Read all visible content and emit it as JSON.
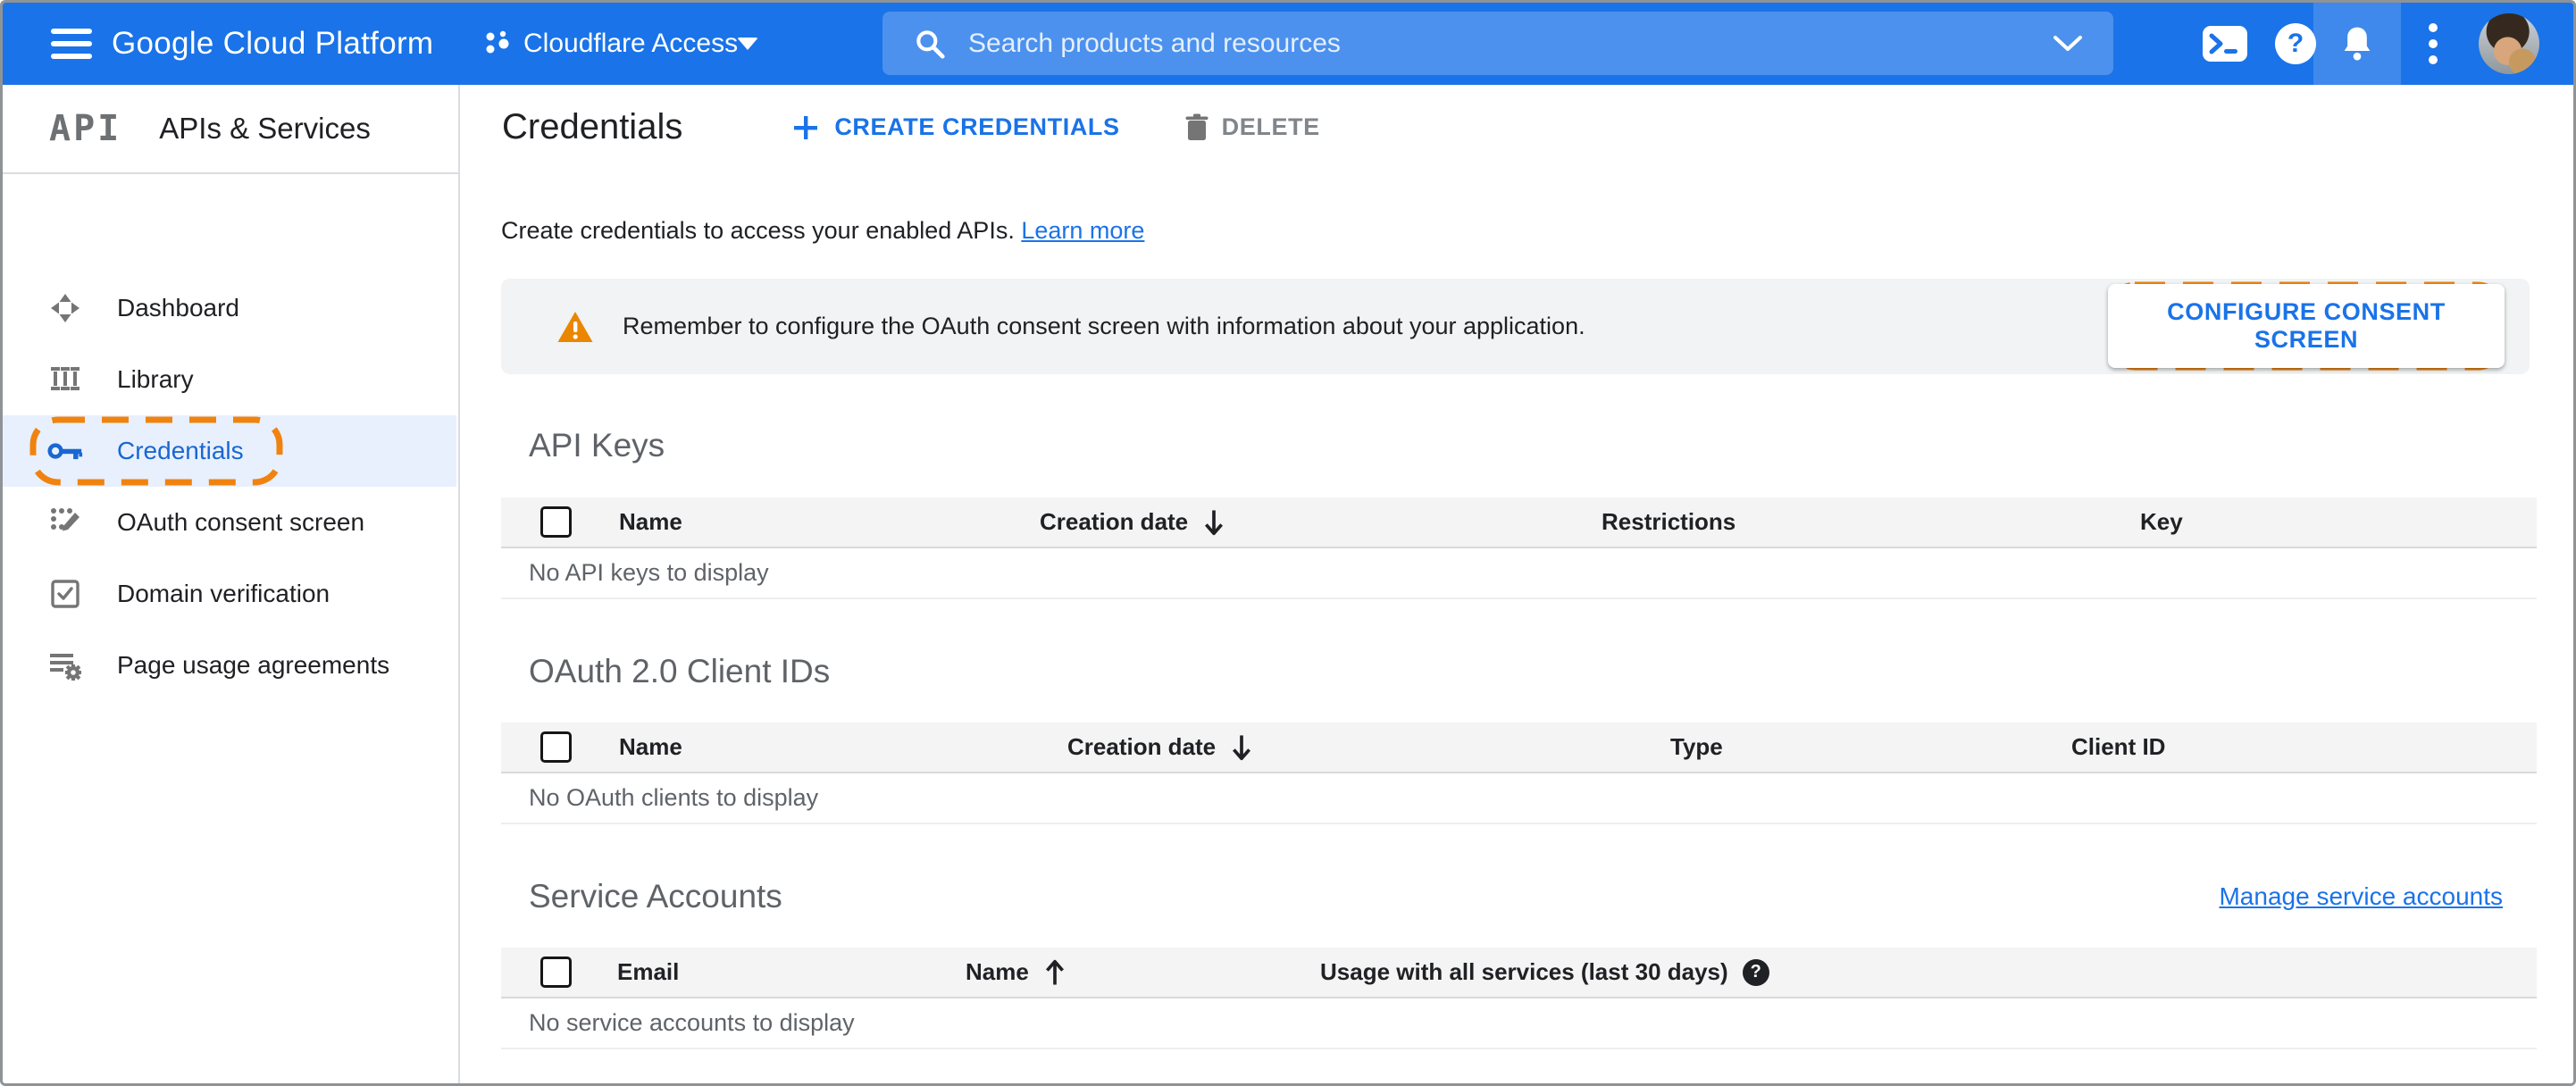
{
  "header": {
    "product": "Google Cloud Platform",
    "project_name": "Cloudflare Access",
    "search_placeholder": "Search products and resources"
  },
  "sidebar": {
    "logo": "API",
    "title": "APIs & Services",
    "items": [
      {
        "label": "Dashboard",
        "icon": "dashboard-icon",
        "active": false
      },
      {
        "label": "Library",
        "icon": "library-icon",
        "active": false
      },
      {
        "label": "Credentials",
        "icon": "key-icon",
        "active": true,
        "annotated": true
      },
      {
        "label": "OAuth consent screen",
        "icon": "consent-icon",
        "active": false
      },
      {
        "label": "Domain verification",
        "icon": "domain-verification-icon",
        "active": false
      },
      {
        "label": "Page usage agreements",
        "icon": "page-usage-icon",
        "active": false
      }
    ]
  },
  "toolbar": {
    "title": "Credentials",
    "create_label": "CREATE CREDENTIALS",
    "delete_label": "DELETE"
  },
  "intro": {
    "text": "Create credentials to access your enabled APIs.",
    "link": "Learn more"
  },
  "banner": {
    "message": "Remember to configure the OAuth consent screen with information about your application.",
    "button": "CONFIGURE CONSENT SCREEN"
  },
  "sections": {
    "api_keys": {
      "title": "API Keys",
      "columns": [
        "Name",
        "Creation date",
        "Restrictions",
        "Key"
      ],
      "sort": {
        "column": "Creation date",
        "direction": "desc"
      },
      "empty": "No API keys to display"
    },
    "oauth_clients": {
      "title": "OAuth 2.0 Client IDs",
      "columns": [
        "Name",
        "Creation date",
        "Type",
        "Client ID"
      ],
      "sort": {
        "column": "Creation date",
        "direction": "desc"
      },
      "empty": "No OAuth clients to display"
    },
    "service_accounts": {
      "title": "Service Accounts",
      "link": "Manage service accounts",
      "columns": [
        "Email",
        "Name",
        "Usage with all services (last 30 days)"
      ],
      "sort": {
        "column": "Name",
        "direction": "asc"
      },
      "empty": "No service accounts to display"
    }
  },
  "icons": {
    "question_mark": "?"
  },
  "colors": {
    "accent_blue": "#1a73e8",
    "active_item_bg": "#e8f0fe",
    "annotation_orange": "#f0830f",
    "warning_orange": "#ea8600",
    "banner_bg": "#f1f3f4"
  }
}
